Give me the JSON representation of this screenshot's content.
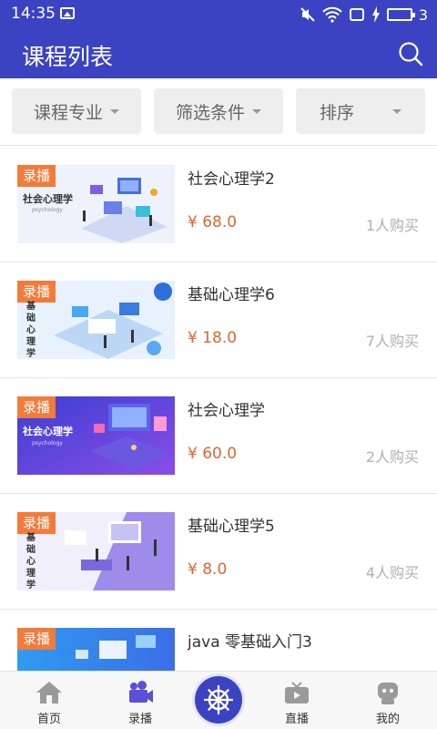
{
  "status_bar": {
    "time": "14:35",
    "battery": "3",
    "icons": [
      "image-icon",
      "mute-icon",
      "wifi-icon",
      "screen-icon",
      "charging-icon",
      "battery-icon"
    ]
  },
  "header": {
    "title": "课程列表",
    "search_icon": "search-icon"
  },
  "filters": [
    {
      "label": "课程专业"
    },
    {
      "label": "筛选条件"
    },
    {
      "label": "排序"
    }
  ],
  "courses": [
    {
      "badge": "录播",
      "caption": "社会心理学",
      "caption_sub": "psychology",
      "title": "社会心理学2",
      "price": "¥  68.0",
      "buyers": "1人购买"
    },
    {
      "badge": "录播",
      "caption": "基础心理学",
      "caption_sub": "",
      "title": "基础心理学6",
      "price": "¥  18.0",
      "buyers": "7人购买"
    },
    {
      "badge": "录播",
      "caption": "社会心理学",
      "caption_sub": "psychology",
      "title": "社会心理学",
      "price": "¥  60.0",
      "buyers": "2人购买"
    },
    {
      "badge": "录播",
      "caption": "基础心理学",
      "caption_sub": "",
      "title": "基础心理学5",
      "price": "¥  8.0",
      "buyers": "4人购买"
    },
    {
      "badge": "录播",
      "caption": "",
      "caption_sub": "",
      "title": "java 零基础入门3",
      "price": "",
      "buyers": ""
    }
  ],
  "bottom_nav": [
    {
      "label": "首页",
      "icon": "home-icon"
    },
    {
      "label": "录播",
      "icon": "video-camera-icon"
    },
    {
      "label": "",
      "icon": "ship-wheel-icon"
    },
    {
      "label": "直播",
      "icon": "tv-icon"
    },
    {
      "label": "我的",
      "icon": "robot-icon"
    }
  ],
  "colors": {
    "primary": "#3c43c2",
    "badge": "#f37b3a",
    "price": "#e0652f",
    "muted": "#b0b0b0"
  }
}
